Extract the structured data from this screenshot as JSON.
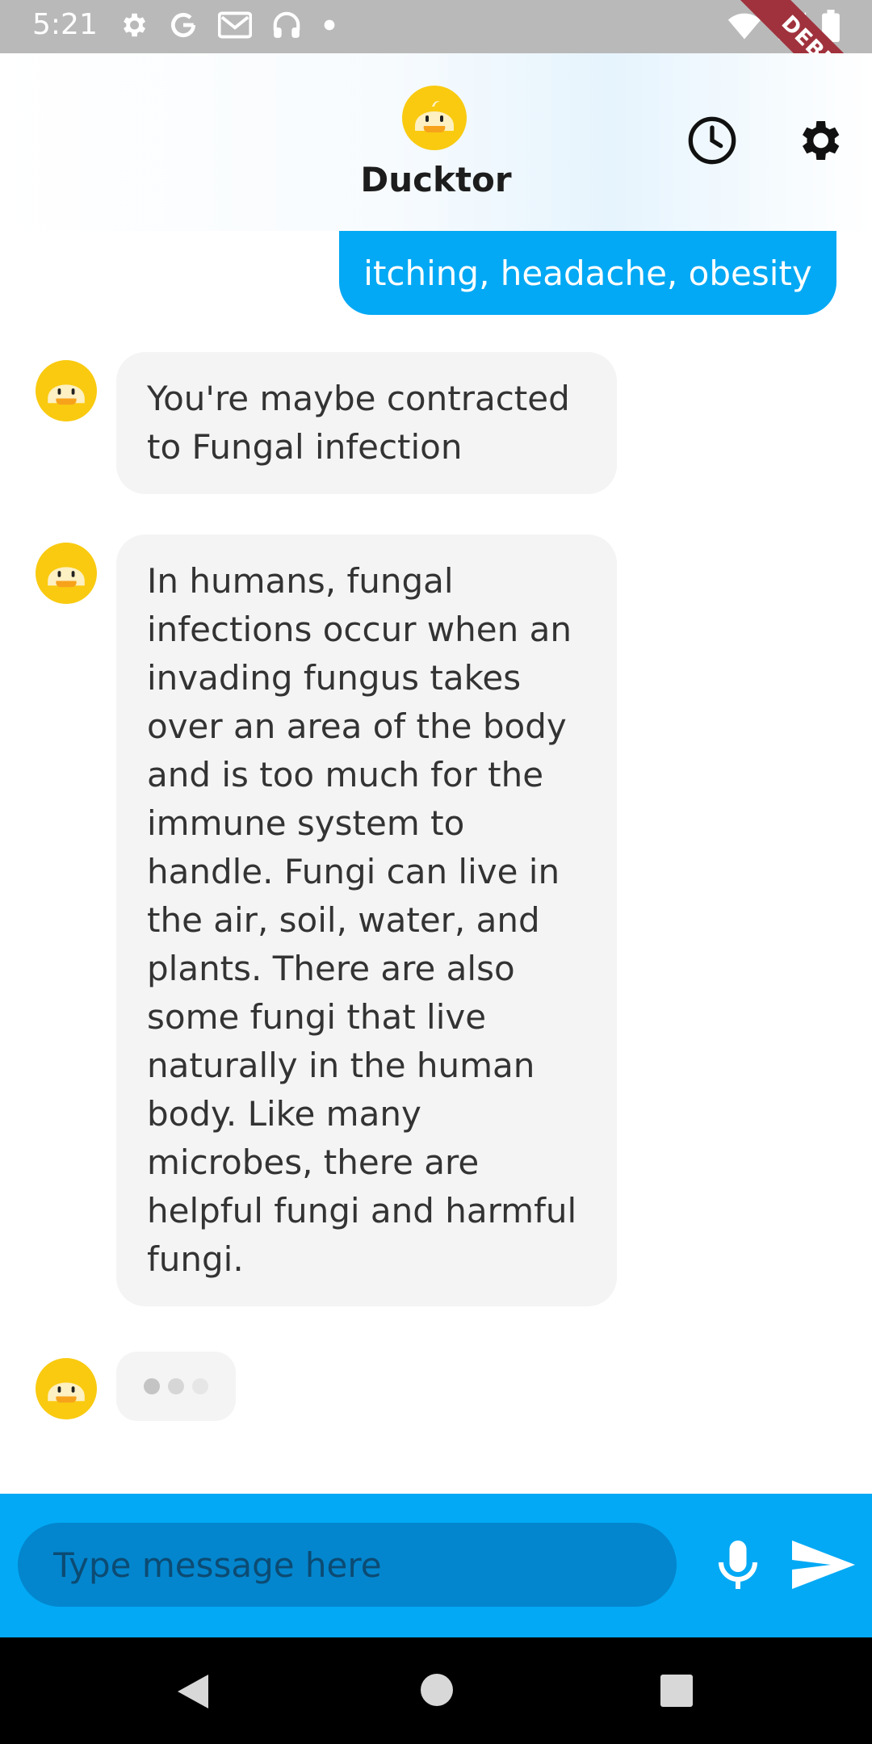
{
  "status_bar": {
    "time": "5:21",
    "icons": [
      "gear-icon",
      "google-icon",
      "mail-icon",
      "headphones-icon",
      "dot-icon"
    ],
    "right_icons": [
      "wifi-icon",
      "signal-icon",
      "battery-icon"
    ],
    "debug_label": "DEBUG"
  },
  "header": {
    "title": "Ducktor",
    "logo": "duck-logo",
    "actions": [
      "history-icon",
      "settings-icon"
    ]
  },
  "messages": [
    {
      "role": "user",
      "text": "itching, headache, obesity"
    },
    {
      "role": "bot",
      "text": "You're maybe contracted to Fungal infection"
    },
    {
      "role": "bot",
      "text": "In humans, fungal infections occur when an invading fungus takes over an area of the body and is too much for the immune system to handle. Fungi can live in the air, soil, water, and plants. There are also some fungi that live naturally in the human body. Like many microbes, there are helpful fungi and harmful fungi."
    }
  ],
  "typing_indicator": {
    "icon": "typing-dots"
  },
  "composer": {
    "placeholder": "Type message here",
    "value": "",
    "mic_icon": "microphone-icon",
    "send_icon": "send-icon"
  },
  "colors": {
    "accent": "#03a9f4",
    "input_bg": "#0386ce",
    "bubble_bg": "#f4f4f4",
    "duck_yellow": "#f9ca10",
    "duck_body": "#fdf0c2",
    "debug_ribbon": "#a0323d"
  },
  "nav_bar": {
    "icons": [
      "back-icon",
      "home-icon",
      "recents-icon"
    ]
  }
}
